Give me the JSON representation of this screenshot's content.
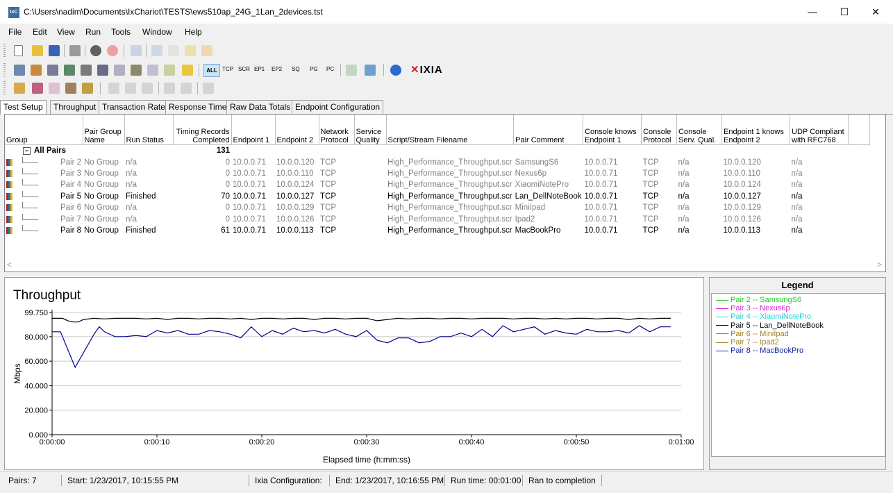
{
  "window": {
    "title": "C:\\Users\\nadim\\Documents\\IxChariot\\TESTS\\ews510ap_24G_1Lan_2devices.tst",
    "minimize": "—",
    "maximize": "☐",
    "close": "✕"
  },
  "menu": [
    "File",
    "Edit",
    "View",
    "Run",
    "Tools",
    "Window",
    "Help"
  ],
  "toolbar2": {
    "all": "ALL",
    "filters": [
      "TCP",
      "SCR",
      "EP1",
      "EP2",
      "SQ",
      "PG",
      "PC"
    ],
    "brand": "IXIA"
  },
  "tabs": [
    "Test Setup",
    "Throughput",
    "Transaction Rate",
    "Response Time",
    "Raw Data Totals",
    "Endpoint Configuration"
  ],
  "grid": {
    "headers": [
      "Group",
      "Pair Group Name",
      "Run Status",
      "Timing Records Completed",
      "Endpoint 1",
      "Endpoint 2",
      "Network Protocol",
      "Service Quality",
      "Script/Stream Filename",
      "Pair Comment",
      "Console knows Endpoint 1",
      "Console Protocol",
      "Console Serv. Qual.",
      "Endpoint 1 knows Endpoint 2",
      "UDP Compliant with RFC768"
    ],
    "group_label": "All Pairs",
    "group_total": "131",
    "rows": [
      {
        "pair": "Pair 2",
        "group": "No Group",
        "status": "n/a",
        "records": "0",
        "ep1": "10.0.0.71",
        "ep2": "10.0.0.120",
        "proto": "TCP",
        "sq": "",
        "script": "High_Performance_Throughput.scr",
        "comment": "SamsungS6",
        "ck1": "10.0.0.71",
        "cproto": "TCP",
        "csq": "n/a",
        "e1k2": "10.0.0.120",
        "udp": "n/a",
        "active": false
      },
      {
        "pair": "Pair 3",
        "group": "No Group",
        "status": "n/a",
        "records": "0",
        "ep1": "10.0.0.71",
        "ep2": "10.0.0.110",
        "proto": "TCP",
        "sq": "",
        "script": "High_Performance_Throughput.scr",
        "comment": "Nexus6p",
        "ck1": "10.0.0.71",
        "cproto": "TCP",
        "csq": "n/a",
        "e1k2": "10.0.0.110",
        "udp": "n/a",
        "active": false
      },
      {
        "pair": "Pair 4",
        "group": "No Group",
        "status": "n/a",
        "records": "0",
        "ep1": "10.0.0.71",
        "ep2": "10.0.0.124",
        "proto": "TCP",
        "sq": "",
        "script": "High_Performance_Throughput.scr",
        "comment": "XiaomiNotePro",
        "ck1": "10.0.0.71",
        "cproto": "TCP",
        "csq": "n/a",
        "e1k2": "10.0.0.124",
        "udp": "n/a",
        "active": false
      },
      {
        "pair": "Pair 5",
        "group": "No Group",
        "status": "Finished",
        "records": "70",
        "ep1": "10.0.0.71",
        "ep2": "10.0.0.127",
        "proto": "TCP",
        "sq": "",
        "script": "High_Performance_Throughput.scr",
        "comment": "Lan_DellNoteBook",
        "ck1": "10.0.0.71",
        "cproto": "TCP",
        "csq": "n/a",
        "e1k2": "10.0.0.127",
        "udp": "n/a",
        "active": true
      },
      {
        "pair": "Pair 6",
        "group": "No Group",
        "status": "n/a",
        "records": "0",
        "ep1": "10.0.0.71",
        "ep2": "10.0.0.129",
        "proto": "TCP",
        "sq": "",
        "script": "High_Performance_Throughput.scr",
        "comment": "MiniIpad",
        "ck1": "10.0.0.71",
        "cproto": "TCP",
        "csq": "n/a",
        "e1k2": "10.0.0.129",
        "udp": "n/a",
        "active": false
      },
      {
        "pair": "Pair 7",
        "group": "No Group",
        "status": "n/a",
        "records": "0",
        "ep1": "10.0.0.71",
        "ep2": "10.0.0.126",
        "proto": "TCP",
        "sq": "",
        "script": "High_Performance_Throughput.scr",
        "comment": "Ipad2",
        "ck1": "10.0.0.71",
        "cproto": "TCP",
        "csq": "n/a",
        "e1k2": "10.0.0.126",
        "udp": "n/a",
        "active": false
      },
      {
        "pair": "Pair 8",
        "group": "No Group",
        "status": "Finished",
        "records": "61",
        "ep1": "10.0.0.71",
        "ep2": "10.0.0.113",
        "proto": "TCP",
        "sq": "",
        "script": "High_Performance_Throughput.scr",
        "comment": "MacBookPro",
        "ck1": "10.0.0.71",
        "cproto": "TCP",
        "csq": "n/a",
        "e1k2": "10.0.0.113",
        "udp": "n/a",
        "active": true
      }
    ]
  },
  "chart_data": {
    "type": "line",
    "title": "Throughput",
    "xlabel": "Elapsed time (h:mm:ss)",
    "ylabel": "Mbps",
    "ylim": [
      0,
      99.75
    ],
    "xlim": [
      0,
      60
    ],
    "yticks": [
      "0.000",
      "20.000",
      "40.000",
      "60.000",
      "80.000",
      "99.750"
    ],
    "ytick_values": [
      0,
      20,
      40,
      60,
      80,
      99.75
    ],
    "xticks": [
      "0:00:00",
      "0:00:10",
      "0:00:20",
      "0:00:30",
      "0:00:40",
      "0:00:50",
      "0:01:00"
    ],
    "xtick_values": [
      0,
      10,
      20,
      30,
      40,
      50,
      60
    ],
    "grid": true,
    "series": [
      {
        "color": "#000000",
        "x": [
          0,
          1,
          1.5,
          2,
          2.5,
          3,
          4,
          5,
          6,
          7,
          8,
          9,
          10,
          11,
          12,
          13,
          14,
          15,
          16,
          17,
          18,
          19,
          20,
          21,
          22,
          23,
          24,
          25,
          26,
          27,
          28,
          29,
          30,
          31,
          32,
          33,
          34,
          35,
          36,
          37,
          38,
          39,
          40,
          41,
          42,
          43,
          44,
          45,
          46,
          47,
          48,
          49,
          50,
          51,
          52,
          53,
          54,
          55,
          56,
          57,
          58,
          59
        ],
        "y": [
          95,
          95,
          93,
          92,
          92,
          94,
          95,
          94.5,
          95,
          95,
          95,
          94.5,
          95,
          94,
          95,
          95,
          94.5,
          95,
          95,
          94.5,
          95,
          94,
          95,
          95,
          94.5,
          95,
          95,
          94,
          95,
          95,
          94.5,
          95,
          95,
          93,
          94,
          95,
          94.5,
          95,
          95,
          94.5,
          95,
          95,
          94.5,
          95,
          95,
          95,
          94.5,
          95,
          95,
          94.5,
          95,
          94.5,
          95,
          95,
          94.5,
          95,
          95,
          94,
          95,
          94.5,
          95,
          95
        ]
      },
      {
        "color": "#00008b",
        "x": [
          0,
          0.8,
          2.2,
          4,
          4.5,
          5,
          6,
          7,
          8,
          9,
          10,
          11,
          12,
          13,
          14,
          15,
          16,
          17,
          18,
          19,
          20,
          21,
          22,
          23,
          24,
          25,
          26,
          27,
          28,
          29,
          30,
          31,
          32,
          33,
          34,
          35,
          36,
          37,
          38,
          39,
          40,
          41,
          42,
          43,
          44,
          45,
          46,
          47,
          48,
          49,
          50,
          51,
          52,
          53,
          54,
          55,
          56,
          57,
          58,
          59
        ],
        "y": [
          84,
          84,
          55,
          82,
          88,
          84,
          80,
          80,
          81,
          80,
          85,
          83,
          85,
          82,
          82,
          85,
          84,
          82,
          79,
          88,
          80,
          85,
          82,
          87,
          84,
          85,
          83,
          86,
          82,
          80,
          85,
          77,
          75,
          79,
          79,
          75,
          76,
          80,
          80,
          83,
          80,
          86,
          80,
          89,
          84,
          86,
          88,
          82,
          85,
          83,
          82,
          86,
          84,
          84,
          85,
          83,
          89,
          84,
          88,
          88
        ]
      }
    ]
  },
  "legend": {
    "title": "Legend",
    "items": [
      {
        "label": "Pair 2 -- SamsungS6",
        "color": "#22cc22"
      },
      {
        "label": "Pair 3 -- Nexus6p",
        "color": "#e020e0"
      },
      {
        "label": "Pair 4 -- XiaomiNotePro",
        "color": "#20d0d0"
      },
      {
        "label": "Pair 5 -- Lan_DellNoteBook",
        "color": "#000000"
      },
      {
        "label": "Pair 6 -- MiniIpad",
        "color": "#a08020"
      },
      {
        "label": "Pair 7 -- Ipad2",
        "color": "#a08020"
      },
      {
        "label": "Pair 8 -- MacBookPro",
        "color": "#1020a0"
      }
    ]
  },
  "status": {
    "pairs": "Pairs: 7",
    "start": "Start: 1/23/2017, 10:15:55 PM",
    "config": "Ixia Configuration:",
    "end": "End: 1/23/2017, 10:16:55 PM",
    "runtime": "Run time: 00:01:00",
    "result": "Ran to completion"
  }
}
